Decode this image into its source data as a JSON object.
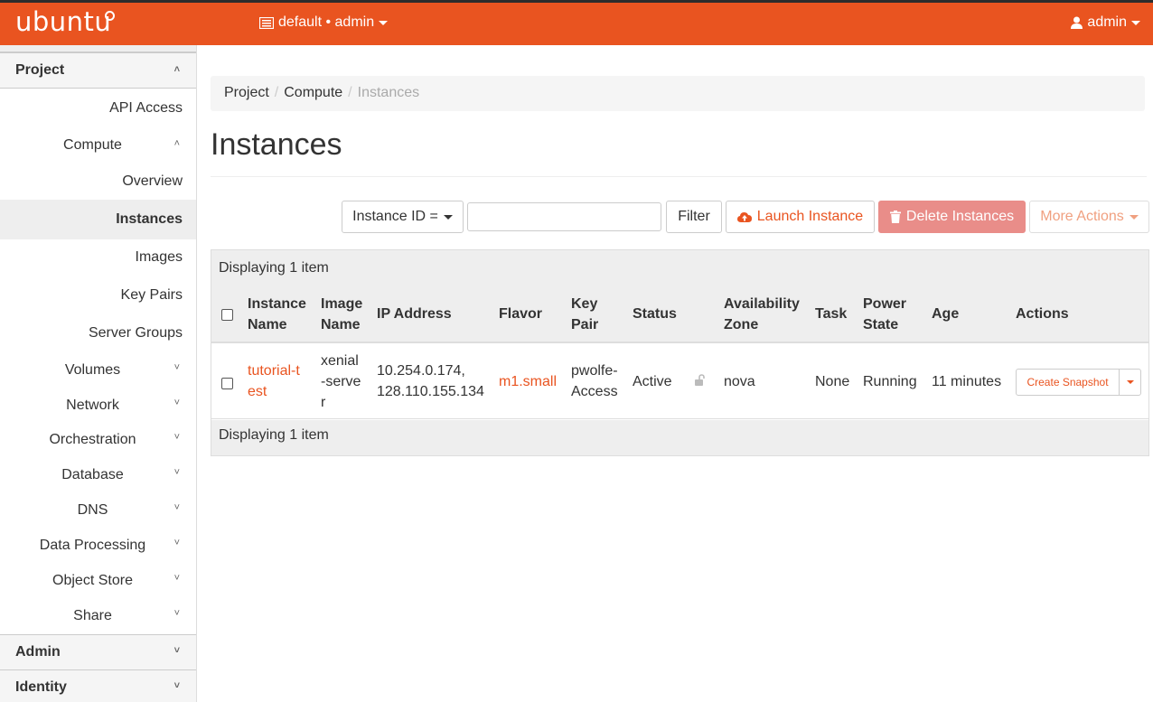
{
  "topbar": {
    "brand": "ubuntu",
    "project_switch": "default • admin",
    "user": "admin"
  },
  "sidebar": {
    "project": "Project",
    "api_access": "API Access",
    "compute": "Compute",
    "overview": "Overview",
    "instances": "Instances",
    "images": "Images",
    "key_pairs": "Key Pairs",
    "server_groups": "Server Groups",
    "volumes": "Volumes",
    "network": "Network",
    "orchestration": "Orchestration",
    "database": "Database",
    "dns": "DNS",
    "data_processing": "Data Processing",
    "object_store": "Object Store",
    "share": "Share",
    "admin": "Admin",
    "identity": "Identity"
  },
  "breadcrumb": {
    "project": "Project",
    "compute": "Compute",
    "current": "Instances",
    "sep": "/"
  },
  "page_title": "Instances",
  "toolbar": {
    "filter_field": "Instance ID =",
    "filter_value": "",
    "filter_btn": "Filter",
    "launch_btn": "Launch Instance",
    "delete_btn": "Delete Instances",
    "more_btn": "More Actions"
  },
  "table": {
    "caption": "Displaying 1 item",
    "footer": "Displaying 1 item",
    "headers": {
      "instance_name_1": "Instance",
      "instance_name_2": "Name",
      "image_name_1": "Image",
      "image_name_2": "Name",
      "ip": "IP Address",
      "flavor": "Flavor",
      "key_pair_1": "Key",
      "key_pair_2": "Pair",
      "status": "Status",
      "zone_1": "Availability",
      "zone_2": "Zone",
      "task": "Task",
      "power_1": "Power",
      "power_2": "State",
      "age": "Age",
      "actions": "Actions"
    },
    "row": {
      "name_1": "tutorial-t",
      "name_2": "est",
      "image_1": "xenial",
      "image_2": "-serve",
      "image_3": "r",
      "ip_1": "10.254.0.174,",
      "ip_2": "128.110.155.134",
      "flavor": "m1.small",
      "key_1": "pwolfe-",
      "key_2": "Access",
      "status": "Active",
      "zone": "nova",
      "task": "None",
      "power": "Running",
      "age": "11 minutes",
      "action": "Create Snapshot"
    }
  },
  "colors": {
    "accent": "#e95420",
    "danger_disabled": "#e98d89"
  }
}
